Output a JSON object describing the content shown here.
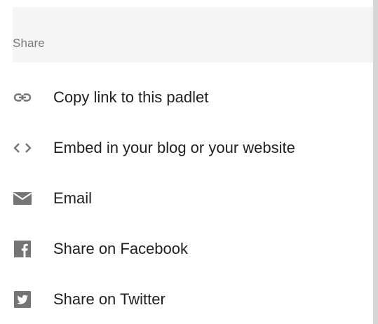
{
  "share_menu": {
    "title": "Share",
    "items": [
      {
        "label": "Copy link to this padlet",
        "icon": "link-icon"
      },
      {
        "label": "Embed in your blog or your website",
        "icon": "code-icon"
      },
      {
        "label": "Email",
        "icon": "email-icon"
      },
      {
        "label": "Share on Facebook",
        "icon": "facebook-icon"
      },
      {
        "label": "Share on Twitter",
        "icon": "twitter-icon"
      }
    ]
  },
  "colors": {
    "header_bg": "#f5f5f5",
    "icon": "#757575",
    "text": "#212121",
    "muted_text": "#7a7a7a"
  }
}
